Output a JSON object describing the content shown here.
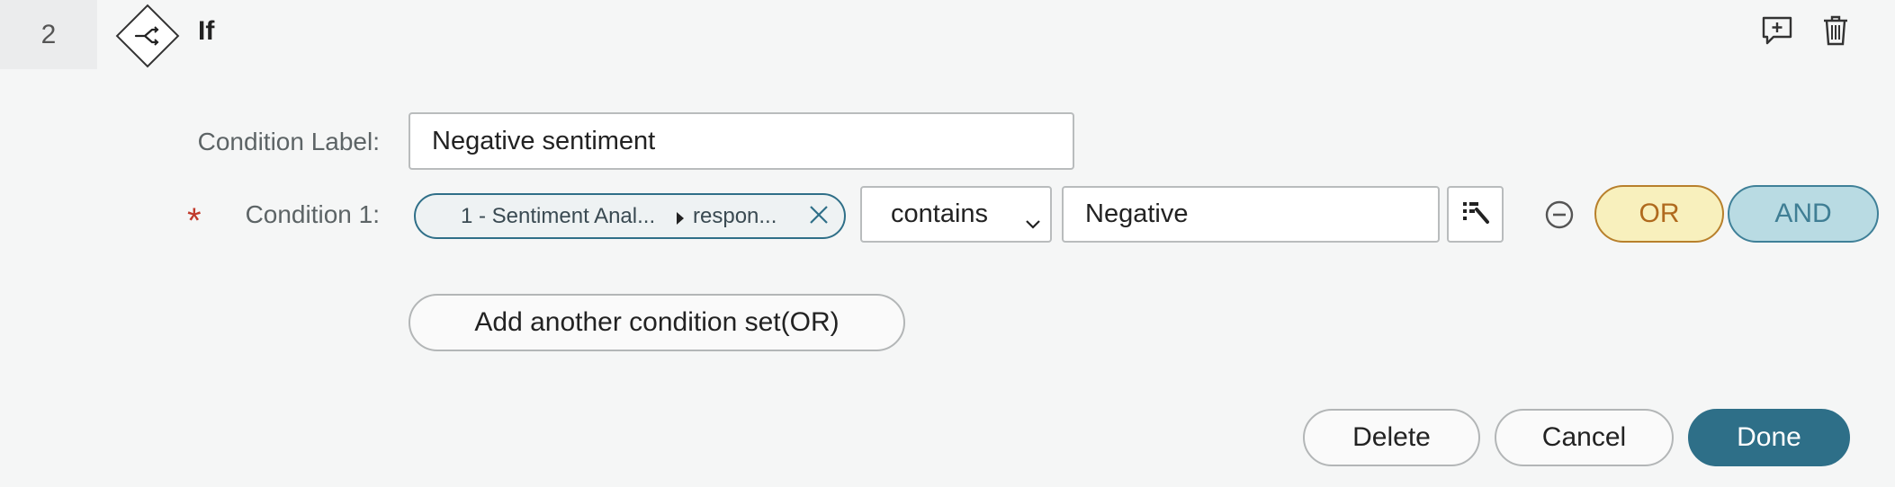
{
  "step": {
    "number": "2",
    "title": "If",
    "icon": "branch-icon"
  },
  "header_actions": {
    "add_comment_icon": "comment-plus-icon",
    "delete_icon": "trash-icon"
  },
  "condition_label": {
    "label": "Condition Label:",
    "value": "Negative sentiment"
  },
  "condition_1": {
    "label": "Condition 1:",
    "required_mark": "*",
    "variable": {
      "source": "1 - Sentiment Anal...",
      "field": "respon..."
    },
    "operator": "contains",
    "value": "Negative"
  },
  "logic_buttons": {
    "or": "OR",
    "and": "AND"
  },
  "add_set_button": "Add another condition set(OR)",
  "footer": {
    "delete": "Delete",
    "cancel": "Cancel",
    "done": "Done"
  },
  "colors": {
    "accent": "#2e6f88",
    "or_bg": "#f8f0bd",
    "or_border": "#b8802c",
    "and_bg": "#b9dbe3",
    "and_border": "#3f8098",
    "required": "#c0392b"
  }
}
